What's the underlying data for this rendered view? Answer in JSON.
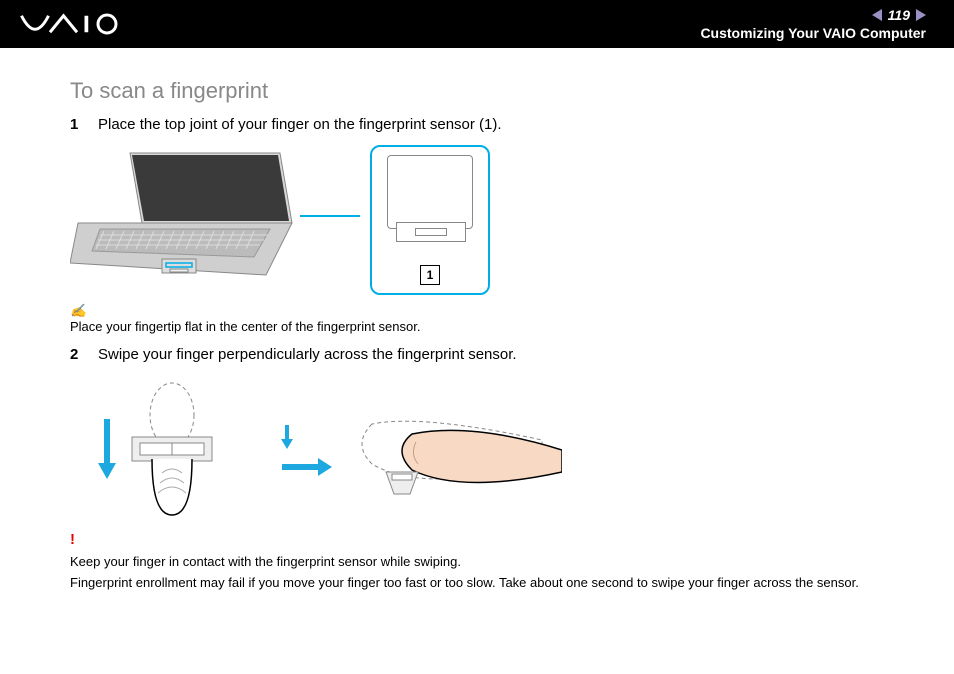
{
  "header": {
    "brand": "VAIO",
    "page_number": "119",
    "section": "Customizing Your VAIO Computer"
  },
  "title": "To scan a fingerprint",
  "steps": [
    {
      "n": "1",
      "text": "Place the top joint of your finger on the fingerprint sensor (1)."
    },
    {
      "n": "2",
      "text": "Swipe your finger perpendicularly across the fingerprint sensor."
    }
  ],
  "callout": {
    "label": "1"
  },
  "tip": {
    "text": "Place your fingertip flat in the center of the fingerprint sensor."
  },
  "warning": {
    "icon": "!",
    "line1": "Keep your finger in contact with the fingerprint sensor while swiping.",
    "line2": "Fingerprint enrollment may fail if you move your finger too fast or too slow. Take about one second to swipe your finger across the sensor."
  }
}
